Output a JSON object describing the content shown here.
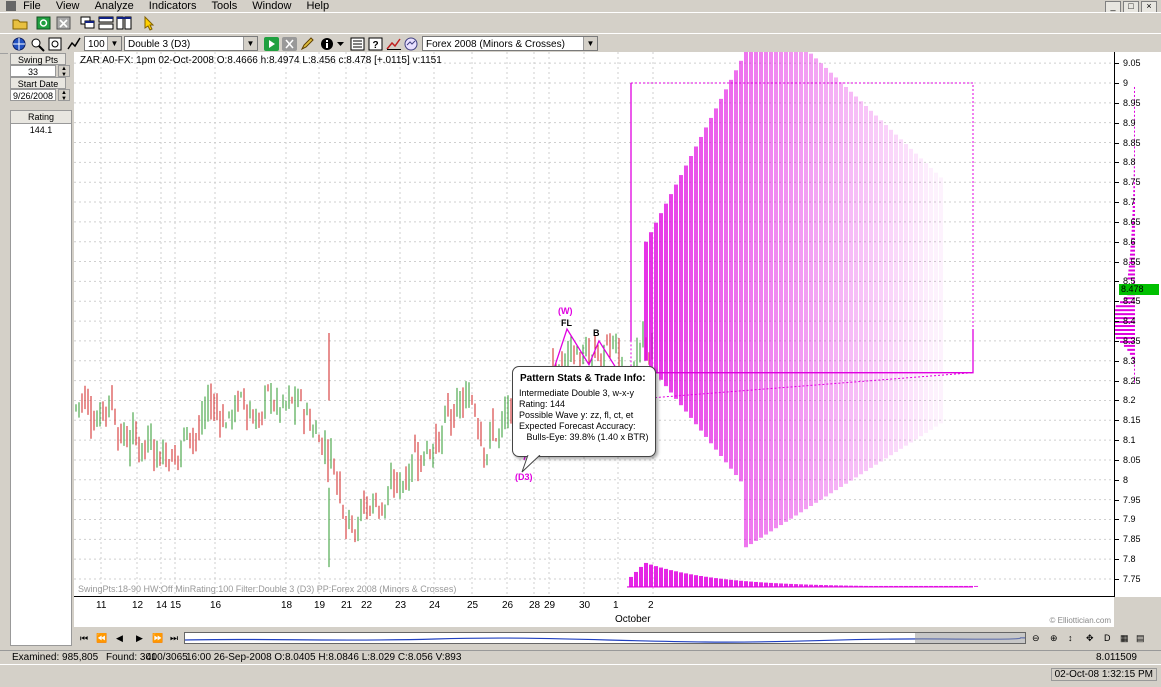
{
  "menu": [
    "File",
    "View",
    "Analyze",
    "Indicators",
    "Tools",
    "Window",
    "Help"
  ],
  "window_controls": [
    "_",
    "□",
    "×"
  ],
  "toolbar2": {
    "zoom_value": "100",
    "pattern_select": "Double 3 (D3)",
    "profile_select": "Forex 2008 (Minors & Crosses)"
  },
  "left_panel": {
    "swing_pts_label": "Swing Pts",
    "swing_pts_value": "33",
    "start_date_label": "Start Date",
    "start_date_value": "9/26/2008",
    "rating_label": "Rating",
    "rating_value": "144.1"
  },
  "chart": {
    "header": "ZAR A0-FX:  1pm 02-Oct-2008  O:8.4666 h:8.4974 L:8.456 c:8.478 [+.0115] v:1151",
    "footer": "SwingPts:18-90 HW:Off  MinRating:100  Filter:Double 3 (D3)  PP:Forex 2008 (Minors & Crosses)",
    "copyright": "© Elliottician.com",
    "wave_labels": {
      "w": "(W)",
      "fl": "FL",
      "b": "B",
      "d3": "(D3)"
    },
    "last_price": "8.478",
    "colors": {
      "up": "#2e9a2e",
      "down": "#d02020",
      "pattern": "#e000e0",
      "marker": "#00c000"
    }
  },
  "chart_data": {
    "type": "candlestick",
    "instrument": "ZAR A0-FX",
    "ylim": [
      7.7,
      9.05
    ],
    "y_ticks": [
      "9.05",
      "9",
      "8.95",
      "8.9",
      "8.85",
      "8.8",
      "8.75",
      "8.7",
      "8.65",
      "8.6",
      "8.55",
      "8.5",
      "8.45",
      "8.4",
      "8.35",
      "8.3",
      "8.25",
      "8.2",
      "8.15",
      "8.1",
      "8.05",
      "8",
      "7.95",
      "7.9",
      "7.85",
      "7.8",
      "7.75"
    ],
    "x_ticks": [
      "11",
      "12",
      "14",
      "15",
      "16",
      "18",
      "19",
      "21",
      "22",
      "23",
      "24",
      "25",
      "26",
      "28",
      "29",
      "30",
      "1",
      "2"
    ],
    "x_month": "October",
    "last_close": 8.478
  },
  "callout": {
    "title": "Pattern Stats & Trade Info:",
    "lines": [
      "Intermediate Double 3, w-x-y",
      "Rating: 144",
      "Possible Wave y:  zz, fl, ct, et",
      "Expected Forecast Accuracy:",
      "   Bulls-Eye: 39.8% (1.40 x BTR)"
    ]
  },
  "navigator": [
    "⏮",
    "⏪",
    "◀",
    "▶",
    "⏩",
    "⏭"
  ],
  "status": {
    "examined": "Examined: 985,805",
    "found": "Found: 301",
    "count": "400/3065",
    "bar": "16:00 26-Sep-2008  O:8.0405 H:8.0846 L:8.029 C:8.056 V:893",
    "cursor_price": "8.011509",
    "datetime": "02-Oct-08 1:32:15 PM"
  }
}
